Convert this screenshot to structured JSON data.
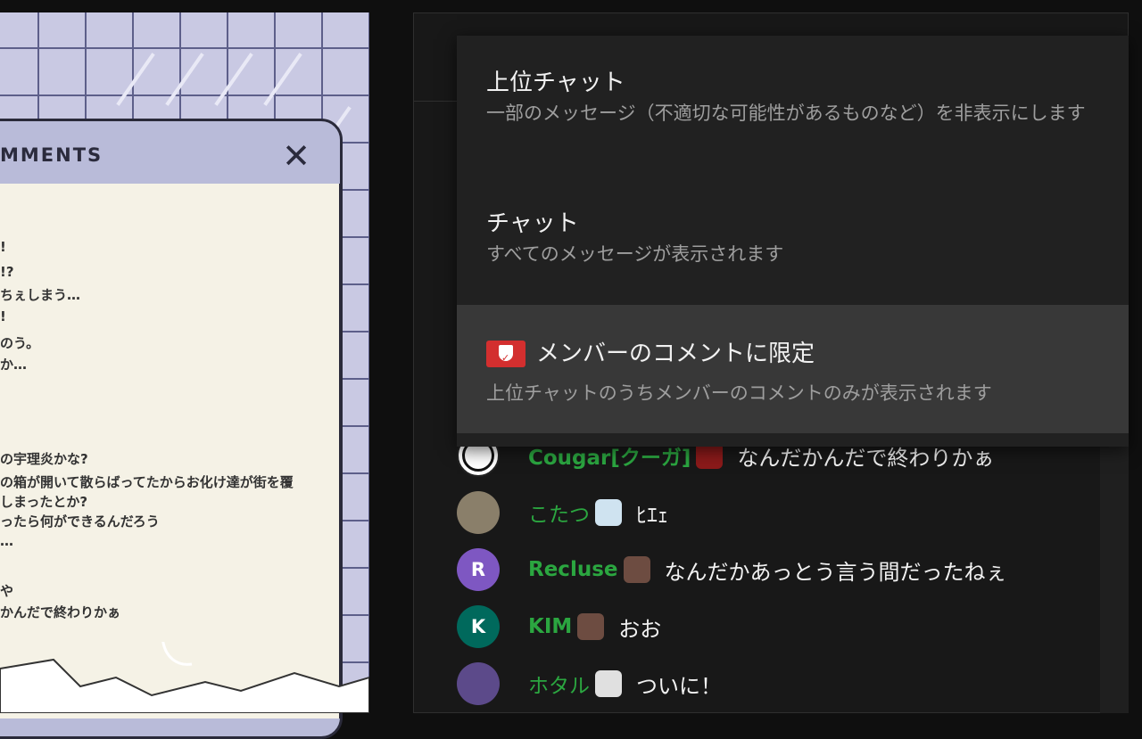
{
  "stream": {
    "comment_panel_title": "MMENTS",
    "comment_lines": [
      "!",
      "!?",
      "ちぇしまう…",
      "!",
      "のう。",
      "か…",
      "の宇理炎かな?",
      "の箱が開いて散らばってたからお化け達が街を覆",
      "しまったとか?",
      "ったら何ができるんだろう",
      "…",
      "や",
      "かんだで終わりかぁ"
    ]
  },
  "chat_mode_menu": {
    "top": {
      "title": "上位チャット",
      "description": "一部のメッセージ（不適切な可能性があるものなど）を非表示にします"
    },
    "all": {
      "title": "チャット",
      "description": "すべてのメッセージが表示されます"
    },
    "members": {
      "title": "メンバーのコメントに限定",
      "description": "上位チャットのうちメンバーのコメントのみが表示されます"
    }
  },
  "messages": [
    {
      "author": "Cougar[クーガ]",
      "text": "なんだかんだで終わりかぁ",
      "avatar_letter": "",
      "avatar_color": "#ffffff",
      "emoji_color": "#8b1a1a"
    },
    {
      "author": "こたつ",
      "text": "ﾋｴｪ",
      "avatar_letter": "",
      "avatar_color": "#8a7f6a",
      "emoji_color": "#cfe3f0"
    },
    {
      "author": "Recluse",
      "text": "なんだかあっとう言う間だったねぇ",
      "avatar_letter": "R",
      "avatar_color": "#7e57c2",
      "emoji_color": "#6d4c41"
    },
    {
      "author": "KIM",
      "text": "おお",
      "avatar_letter": "K",
      "avatar_color": "#00695c",
      "emoji_color": "#6d4c41"
    },
    {
      "author": "ホタル",
      "text": "ついに！",
      "avatar_letter": "",
      "avatar_color": "#5c4a8a",
      "emoji_color": "#e0e0e0"
    }
  ]
}
